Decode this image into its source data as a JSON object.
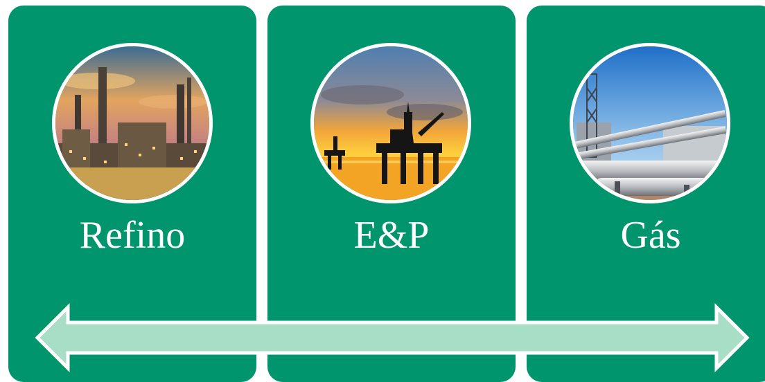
{
  "segments": [
    {
      "label": "Refino",
      "image": "oil-refinery-at-sunset"
    },
    {
      "label": "E&P",
      "image": "offshore-oil-platform-at-sunset"
    },
    {
      "label": "Gás",
      "image": "gas-pipelines"
    }
  ],
  "colors": {
    "panel": "#00956d",
    "arrow_fill": "#a9dec6",
    "arrow_stroke": "#ffffff",
    "label_text": "#ffffff"
  },
  "arrow": {
    "type": "double-headed",
    "direction": "horizontal"
  }
}
